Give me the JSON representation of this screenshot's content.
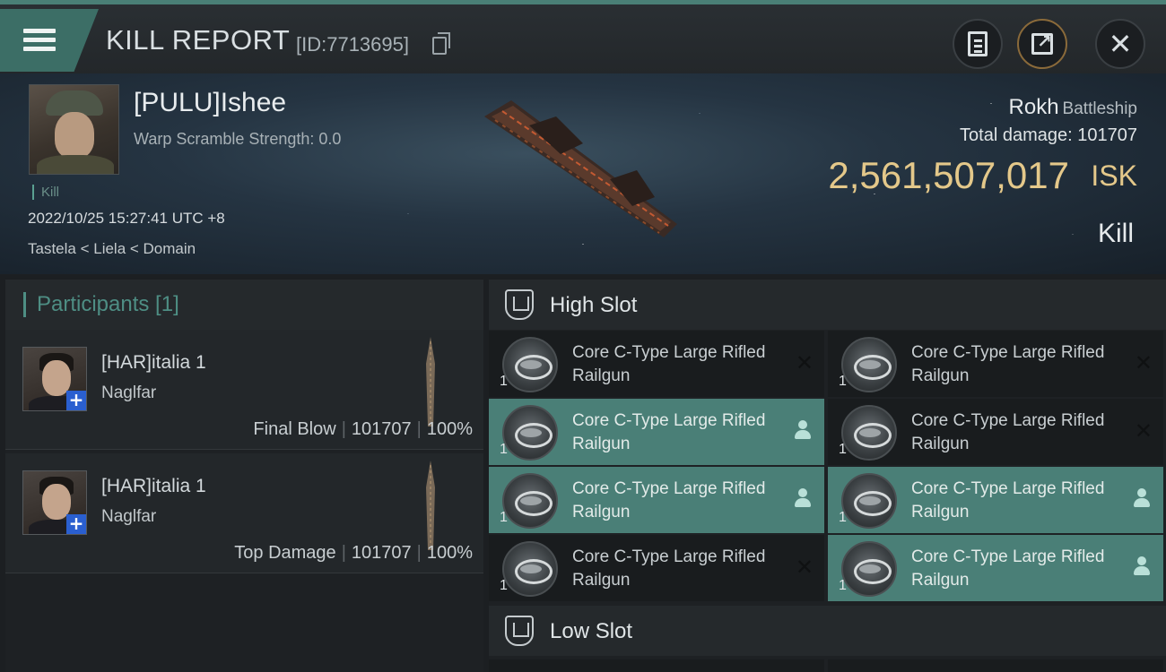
{
  "header": {
    "title": "KILL REPORT",
    "report_id": "[ID:7713695]"
  },
  "victim": {
    "name": "[PULU]Ishee",
    "warp_scramble": "Warp Scramble Strength: 0.0",
    "kill_tag": "Kill",
    "datetime": "2022/10/25 15:27:41 UTC +8",
    "location": "Tastela < Liela < Domain",
    "ship_name": "Rokh",
    "ship_class": "Battleship",
    "total_damage_label": "Total damage:",
    "total_damage": "101707",
    "isk_value": "2,561,507,017",
    "isk_unit": "ISK",
    "result": "Kill"
  },
  "participants": {
    "title": "Participants [1]",
    "rows": [
      {
        "name": "[HAR]italia 1",
        "ship": "Naglfar",
        "role": "Final Blow",
        "damage": "101707",
        "percent": "100%"
      },
      {
        "name": "[HAR]italia 1",
        "ship": "Naglfar",
        "role": "Top Damage",
        "damage": "101707",
        "percent": "100%"
      }
    ]
  },
  "high_slot": {
    "label": "High Slot",
    "modules": [
      {
        "name": "Core C-Type Large Rifled Railgun",
        "qty": "1",
        "status": "destroyed"
      },
      {
        "name": "Core C-Type Large Rifled Railgun",
        "qty": "1",
        "status": "destroyed"
      },
      {
        "name": "Core C-Type Large Rifled Railgun",
        "qty": "1",
        "status": "dropped"
      },
      {
        "name": "Core C-Type Large Rifled Railgun",
        "qty": "1",
        "status": "destroyed"
      },
      {
        "name": "Core C-Type Large Rifled Railgun",
        "qty": "1",
        "status": "dropped"
      },
      {
        "name": "Core C-Type Large Rifled Railgun",
        "qty": "1",
        "status": "dropped"
      },
      {
        "name": "Core C-Type Large Rifled Railgun",
        "qty": "1",
        "status": "destroyed"
      },
      {
        "name": "Core C-Type Large Rifled Railgun",
        "qty": "1",
        "status": "dropped"
      }
    ]
  },
  "low_slot": {
    "label": "Low Slot"
  },
  "icons": {
    "menu": "hamburger-icon",
    "copy": "copy-icon",
    "clipboard": "clipboard-icon",
    "export": "export-icon",
    "close": "close-icon",
    "destroyed": "x-icon",
    "dropped": "person-icon"
  },
  "colors": {
    "accent": "#4a7f77",
    "isk": "#e4c88a",
    "dropped_bg": "#4a7f77",
    "destroyed_bg": "#191c1e"
  }
}
